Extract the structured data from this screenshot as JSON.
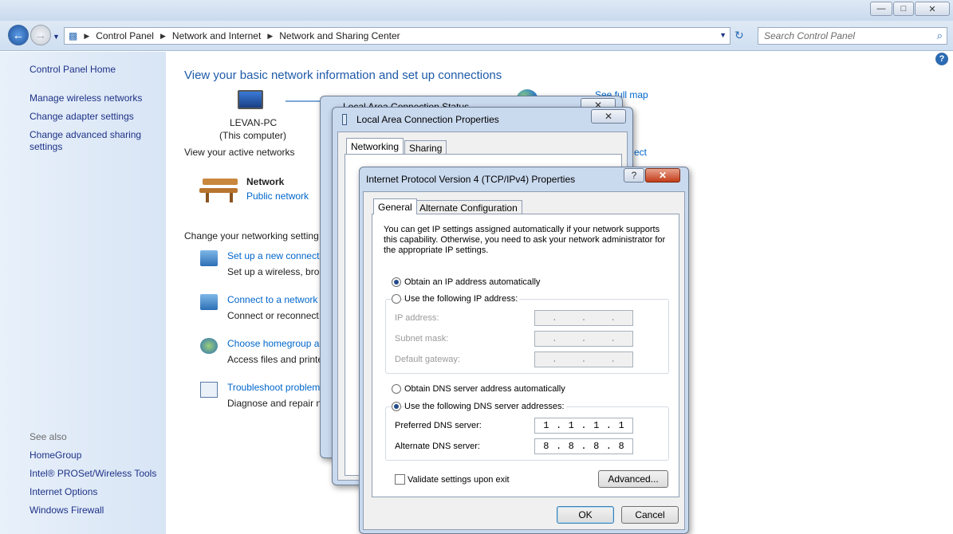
{
  "window": {
    "min": "—",
    "max": "□",
    "close": "✕"
  },
  "nav": {
    "breadcrumb": [
      "Control Panel",
      "Network and Internet",
      "Network and Sharing Center"
    ],
    "search_placeholder": "Search Control Panel"
  },
  "sidebar": {
    "home": "Control Panel Home",
    "items": [
      "Manage wireless networks",
      "Change adapter settings",
      "Change advanced sharing",
      "settings"
    ],
    "see_also_title": "See also",
    "see_also": [
      "HomeGroup",
      "Intel® PROSet/Wireless Tools",
      "Internet Options",
      "Windows Firewall"
    ]
  },
  "main": {
    "heading": "View your basic network information and set up connections",
    "computer_name": "LEVAN-PC",
    "computer_sub": "(This computer)",
    "see_full_map": "See full map",
    "active_networks": "View your active networks",
    "network_name": "Network",
    "network_type": "Public network",
    "connect_partial": "ect",
    "change_settings": "Change your networking setting",
    "tasks": [
      {
        "link": "Set up a new connecti",
        "desc": "Set up a wireless, broa"
      },
      {
        "link": "Connect to a network",
        "desc": "Connect or reconnect"
      },
      {
        "link": "Choose homegroup a",
        "desc": "Access files and printe"
      },
      {
        "link": "Troubleshoot problem",
        "desc": "Diagnose and repair n"
      }
    ]
  },
  "status_window": {
    "title": "Local Area Connection Status"
  },
  "props_window": {
    "title": "Local Area Connection Properties",
    "tabs": [
      "Networking",
      "Sharing"
    ]
  },
  "ipv4": {
    "title": "Internet Protocol Version 4 (TCP/IPv4) Properties",
    "help": "?",
    "close": "✕",
    "tabs": [
      "General",
      "Alternate Configuration"
    ],
    "intro": "You can get IP settings assigned automatically if your network supports this capability. Otherwise, you need to ask your network administrator for the appropriate IP settings.",
    "obtain_ip": "Obtain an IP address automatically",
    "use_ip": "Use the following IP address:",
    "ip_label": "IP address:",
    "subnet_label": "Subnet mask:",
    "gateway_label": "Default gateway:",
    "obtain_dns": "Obtain DNS server address automatically",
    "use_dns": "Use the following DNS server addresses:",
    "pref_label": "Preferred DNS server:",
    "alt_label": "Alternate DNS server:",
    "pref_dns": [
      "1",
      "1",
      "1",
      "1"
    ],
    "alt_dns": [
      "8",
      "8",
      "8",
      "8"
    ],
    "validate": "Validate settings upon exit",
    "advanced": "Advanced...",
    "ok": "OK",
    "cancel": "Cancel"
  }
}
